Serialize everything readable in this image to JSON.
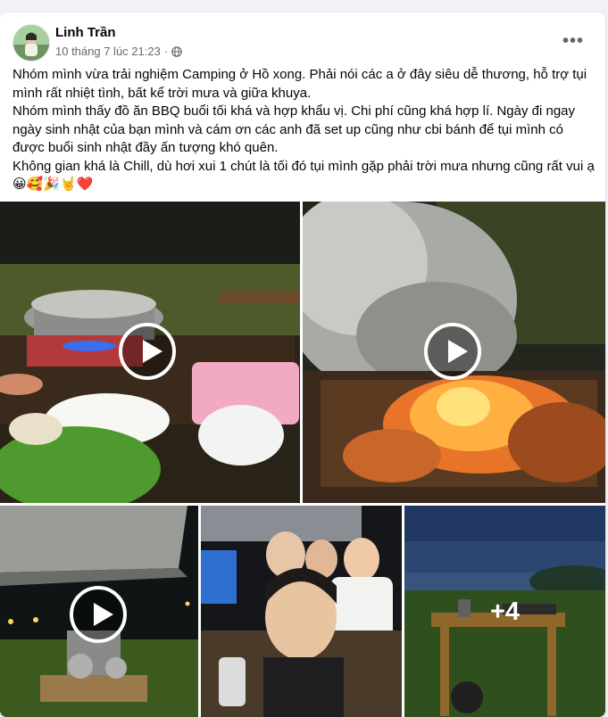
{
  "post": {
    "author": "Linh Trần",
    "timestamp": "10 tháng 7 lúc 21:23",
    "audience_icon": "globe-icon",
    "more_label": "•••",
    "paragraphs": [
      "Nhóm mình vừa trải nghiệm Camping ở Hồ xong. Phải nói các a ở đây siêu dễ thương, hỗ trợ tụi mình rất nhiệt tình, bất kể trời mưa và giữa khuya.",
      "Nhóm mình thấy đồ ăn BBQ buổi tối khá và hợp khẩu vị. Chi phí cũng khá hợp lí. Ngày đi ngay ngày sinh nhật của bạn mình và cám ơn các anh đã set up cũng như cbi bánh để tụi mình có được buổi sinh nhật đầy ấn tượng khó quên.",
      "Không gian khá là Chill, dù hơi xui 1 chút là tối đó tụi mình gặp phải trời mưa nhưng cũng rất vui ạ😀🥰🎉🤘❤️"
    ]
  },
  "media": {
    "more_count": "+4",
    "tiles": [
      {
        "label": "bbq-hotpot-video",
        "type": "video"
      },
      {
        "label": "grill-fire-video",
        "type": "video"
      },
      {
        "label": "tent-night-video",
        "type": "video"
      },
      {
        "label": "group-selfie-photo",
        "type": "photo"
      },
      {
        "label": "lake-table-photo",
        "type": "photo"
      }
    ]
  },
  "colors": {
    "text": "#050505",
    "secondary": "#65676b",
    "background": "#f0f2f5"
  }
}
